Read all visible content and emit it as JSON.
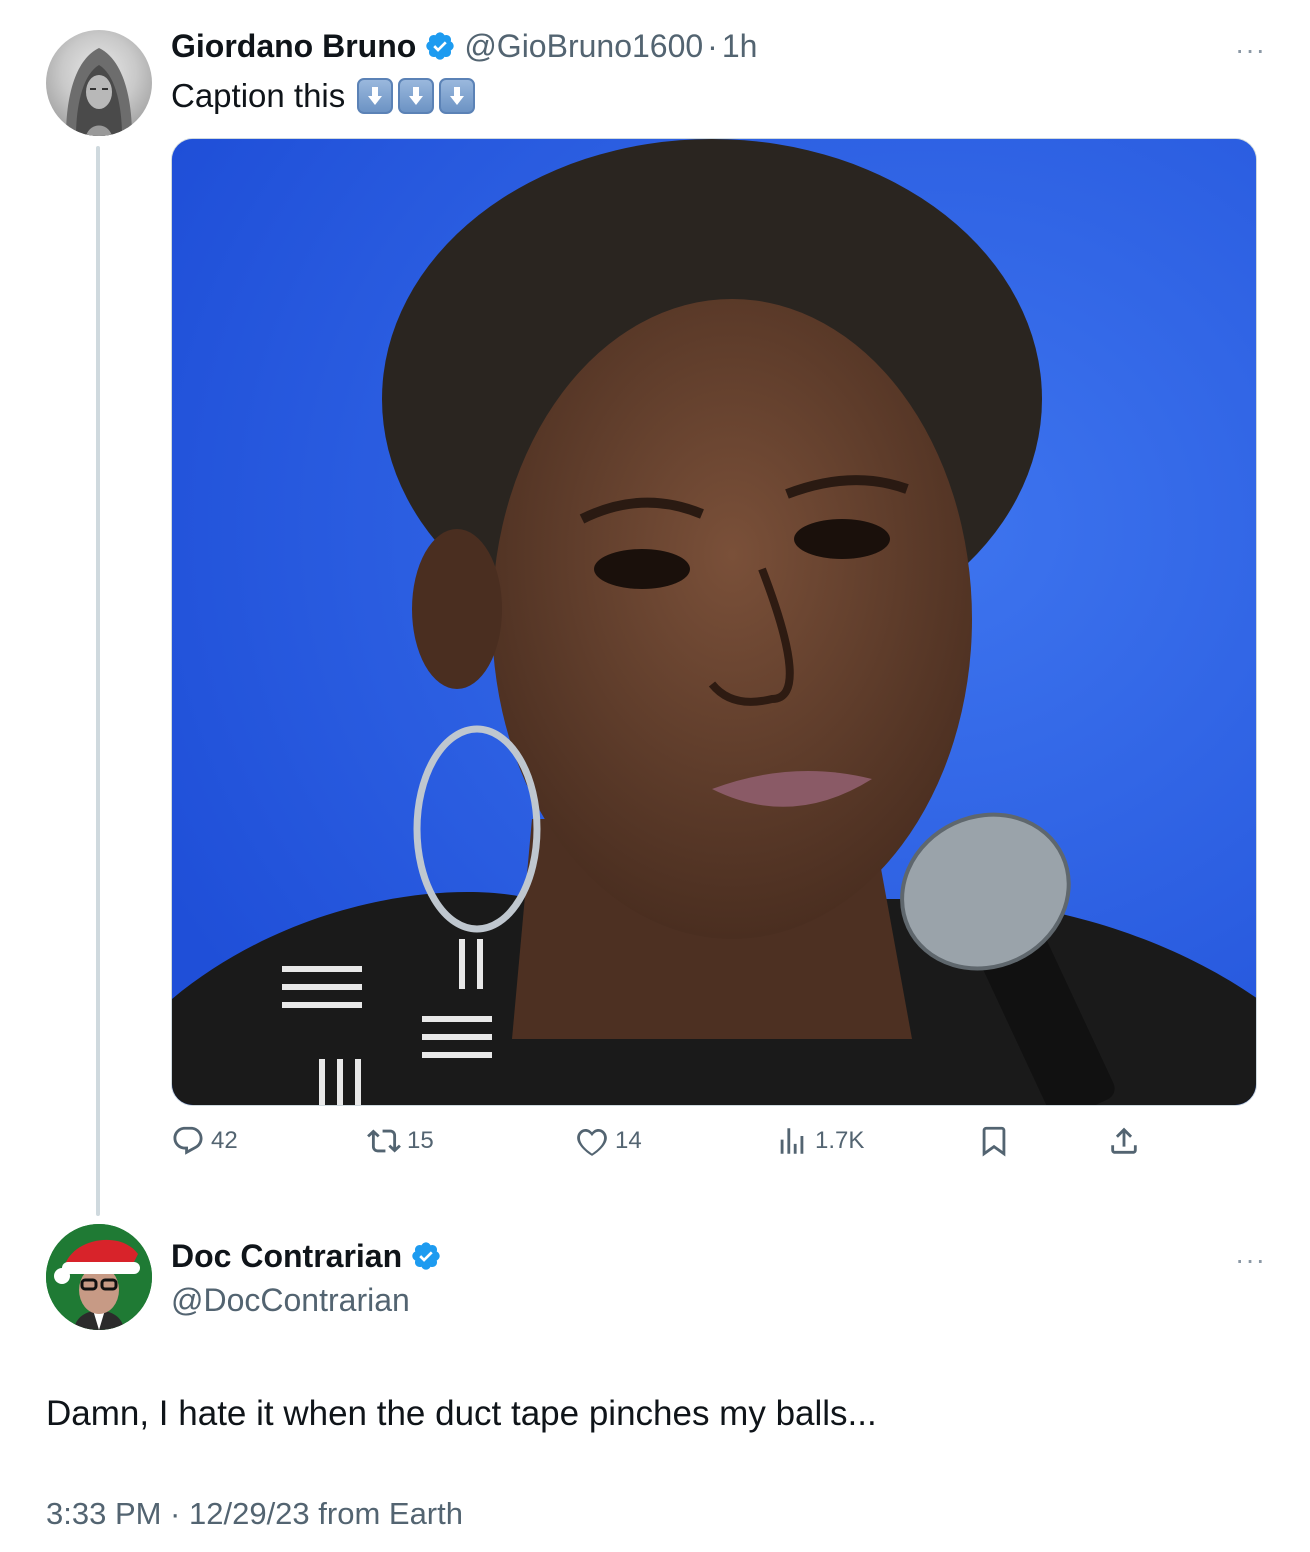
{
  "parent_tweet": {
    "author_name": "Giordano Bruno",
    "handle": "@GioBruno1600",
    "separator": "·",
    "time_ago": "1h",
    "text": "Caption this",
    "more_label": "···",
    "emojis": [
      "down-arrow",
      "down-arrow",
      "down-arrow"
    ],
    "stats": {
      "replies": "42",
      "reposts": "15",
      "likes": "14",
      "views": "1.7K"
    }
  },
  "reply_tweet": {
    "author_name": "Doc Contrarian",
    "handle": "@DocContrarian",
    "more_label": "···",
    "text": "Damn, I hate it when the duct tape pinches my balls...",
    "timestamp": "3:33 PM · 12/29/23 from Earth"
  },
  "colors": {
    "verified_blue": "#1d9bf0",
    "secondary_text": "#536471",
    "primary_text": "#0f1419",
    "thread_line": "#cfd9de",
    "photo_background_blue": "#2459e6"
  },
  "icons": {
    "reply": "speech-bubble-icon",
    "repost": "repost-arrows-icon",
    "like": "heart-icon",
    "views": "bar-chart-icon",
    "bookmark": "bookmark-icon",
    "share": "share-upload-icon"
  }
}
